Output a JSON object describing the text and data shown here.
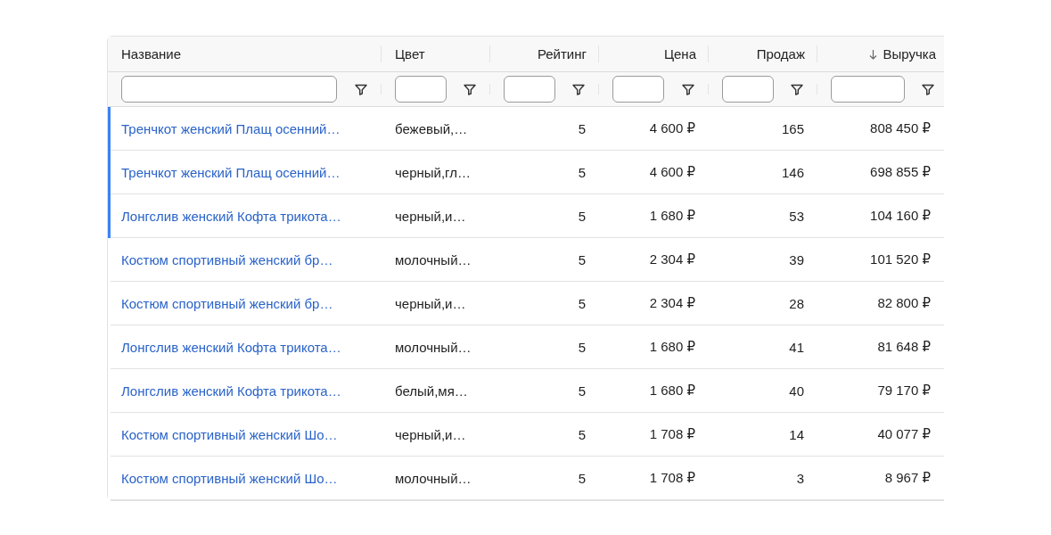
{
  "table": {
    "columns": [
      {
        "label": "Название",
        "sorted_descending": false
      },
      {
        "label": "Цвет",
        "sorted_descending": false
      },
      {
        "label": "Рейтинг",
        "sorted_descending": false
      },
      {
        "label": "Цена",
        "sorted_descending": false
      },
      {
        "label": "Продаж",
        "sorted_descending": false
      },
      {
        "label": "Выручка",
        "sorted_descending": true
      }
    ],
    "rows": [
      {
        "highlighted": true,
        "cells": [
          "Тренчкот женский Плащ осенний…",
          "бежевый,…",
          "5",
          "4 600 ₽",
          "165",
          "808 450 ₽"
        ]
      },
      {
        "highlighted": true,
        "cells": [
          "Тренчкот женский Плащ осенний…",
          "черный,гл…",
          "5",
          "4 600 ₽",
          "146",
          "698 855 ₽"
        ]
      },
      {
        "highlighted": true,
        "cells": [
          "Лонгслив женский Кофта трикота…",
          "черный,и…",
          "5",
          "1 680 ₽",
          "53",
          "104 160 ₽"
        ]
      },
      {
        "highlighted": false,
        "cells": [
          "Костюм спортивный женский бр…",
          "молочный…",
          "5",
          "2 304 ₽",
          "39",
          "101 520 ₽"
        ]
      },
      {
        "highlighted": false,
        "cells": [
          "Костюм спортивный женский бр…",
          "черный,и…",
          "5",
          "2 304 ₽",
          "28",
          "82 800 ₽"
        ]
      },
      {
        "highlighted": false,
        "cells": [
          "Лонгслив женский Кофта трикота…",
          "молочный…",
          "5",
          "1 680 ₽",
          "41",
          "81 648 ₽"
        ]
      },
      {
        "highlighted": false,
        "cells": [
          "Лонгслив женский Кофта трикота…",
          "белый,мя…",
          "5",
          "1 680 ₽",
          "40",
          "79 170 ₽"
        ]
      },
      {
        "highlighted": false,
        "cells": [
          "Костюм спортивный женский Шо…",
          "черный,и…",
          "5",
          "1 708 ₽",
          "14",
          "40 077 ₽"
        ]
      },
      {
        "highlighted": false,
        "cells": [
          "Костюм спортивный женский Шо…",
          "молочный…",
          "5",
          "1 708 ₽",
          "3",
          "8 967 ₽"
        ]
      }
    ]
  }
}
